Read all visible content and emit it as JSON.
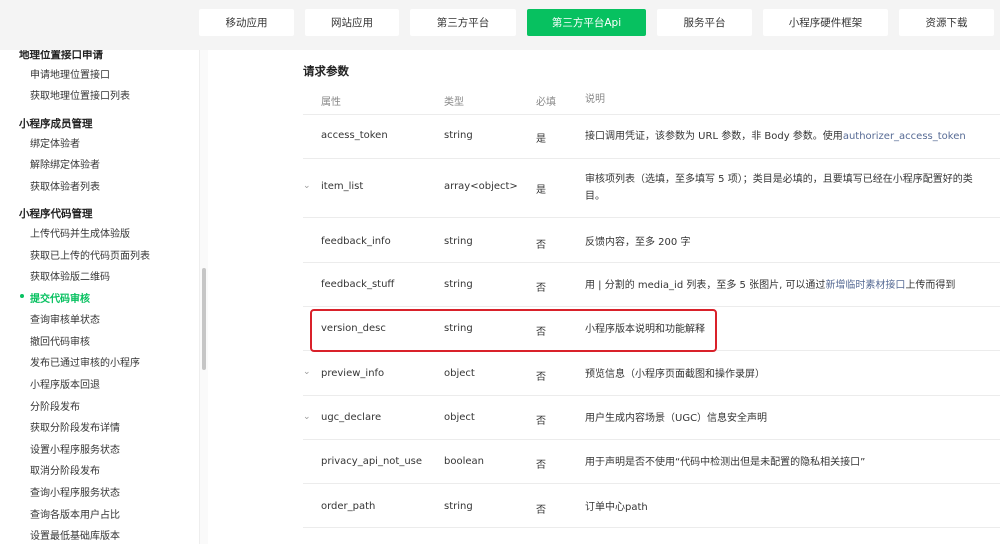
{
  "nav": {
    "items": [
      {
        "label": "移动应用"
      },
      {
        "label": "网站应用"
      },
      {
        "label": "第三方平台"
      },
      {
        "label": "第三方平台Api",
        "active": true
      },
      {
        "label": "服务平台"
      },
      {
        "label": "小程序硬件框架"
      },
      {
        "label": "资源下载"
      }
    ]
  },
  "sidebar": {
    "group_location": "地理位置接口申请",
    "location_items": [
      "申请地理位置接口",
      "获取地理位置接口列表"
    ],
    "group_members": "小程序成员管理",
    "member_items": [
      "绑定体验者",
      "解除绑定体验者",
      "获取体验者列表"
    ],
    "group_code": "小程序代码管理",
    "code_items": [
      "上传代码并生成体验版",
      "获取已上传的代码页面列表",
      "获取体验版二维码",
      "提交代码审核",
      "查询审核单状态",
      "撤回代码审核",
      "发布已通过审核的小程序",
      "小程序版本回退",
      "分阶段发布",
      "获取分阶段发布详情",
      "设置小程序服务状态",
      "取消分阶段发布",
      "查询小程序服务状态",
      "查询各版本用户占比",
      "设置最低基础库版本"
    ],
    "active_item": "提交代码审核"
  },
  "main": {
    "section_title": "请求参数",
    "columns": [
      "属性",
      "类型",
      "必填",
      "说明"
    ],
    "rows": [
      {
        "name": "access_token",
        "type": "string",
        "required": "是",
        "desc": "接口调用凭证，该参数为 URL 参数，非 Body 参数。使用",
        "link": "authorizer_access_token",
        "desc_after": ""
      },
      {
        "name": "item_list",
        "type": "array<object>",
        "required": "是",
        "desc": "审核项列表（选填，至多填写 5 项）；类目是必填的，且要填写已经在小程序配置好的类目。",
        "link": "",
        "desc_after": "",
        "expandable": true
      },
      {
        "name": "feedback_info",
        "type": "string",
        "required": "否",
        "desc": "反馈内容，至多 200 字",
        "link": "",
        "desc_after": ""
      },
      {
        "name": "feedback_stuff",
        "type": "string",
        "required": "否",
        "desc": "用 | 分割的 media_id 列表，至多 5 张图片, 可以通过",
        "link": "新增临时素材接口",
        "desc_after": "上传而得到"
      },
      {
        "name": "version_desc",
        "type": "string",
        "required": "否",
        "desc": "小程序版本说明和功能解释",
        "link": "",
        "desc_after": ""
      },
      {
        "name": "preview_info",
        "type": "object",
        "required": "否",
        "desc": "预览信息（小程序页面截图和操作录屏）",
        "link": "",
        "desc_after": "",
        "expandable": true
      },
      {
        "name": "ugc_declare",
        "type": "object",
        "required": "否",
        "desc": "用户生成内容场景（UGC）信息安全声明",
        "link": "",
        "desc_after": "",
        "expandable": true
      },
      {
        "name": "privacy_api_not_use",
        "type": "boolean",
        "required": "否",
        "desc": "用于声明是否不使用“代码中检测出但是未配置的隐私相关接口”",
        "link": "",
        "desc_after": ""
      },
      {
        "name": "order_path",
        "type": "string",
        "required": "否",
        "desc": "订单中心path",
        "link": "",
        "desc_after": ""
      }
    ]
  },
  "colors": {
    "accent": "#07c160",
    "link": "#576b95",
    "highlight": "#d9212a"
  },
  "icons": {
    "expand": "chevron-down-icon"
  }
}
